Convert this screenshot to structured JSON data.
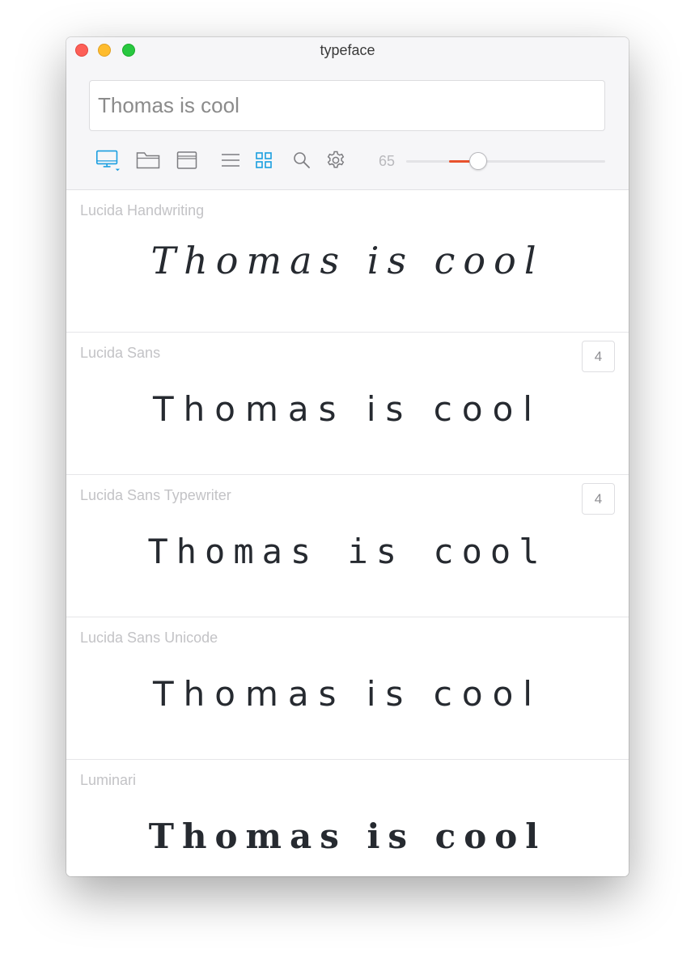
{
  "window": {
    "title": "typeface"
  },
  "search": {
    "value": "Thomas is cool",
    "placeholder": ""
  },
  "toolbar": {
    "icons": [
      "monitor-icon",
      "folder-icon",
      "window-icon",
      "list-view-icon",
      "grid-view-icon",
      "search-icon",
      "gear-icon"
    ],
    "size_value": "65",
    "slider_level": 0.36,
    "accent_color": "#1a9ee0",
    "slider_color": "#e8522d"
  },
  "fonts": [
    {
      "name": "Lucida Handwriting",
      "sample": "Thomas is cool",
      "count": ""
    },
    {
      "name": "Lucida Sans",
      "sample": "Thomas is cool",
      "count": "4"
    },
    {
      "name": "Lucida Sans Typewriter",
      "sample": "Thomas is cool",
      "count": "4"
    },
    {
      "name": "Lucida Sans Unicode",
      "sample": "Thomas is cool",
      "count": ""
    },
    {
      "name": "Luminari",
      "sample": "Thomas is cool",
      "count": ""
    }
  ]
}
